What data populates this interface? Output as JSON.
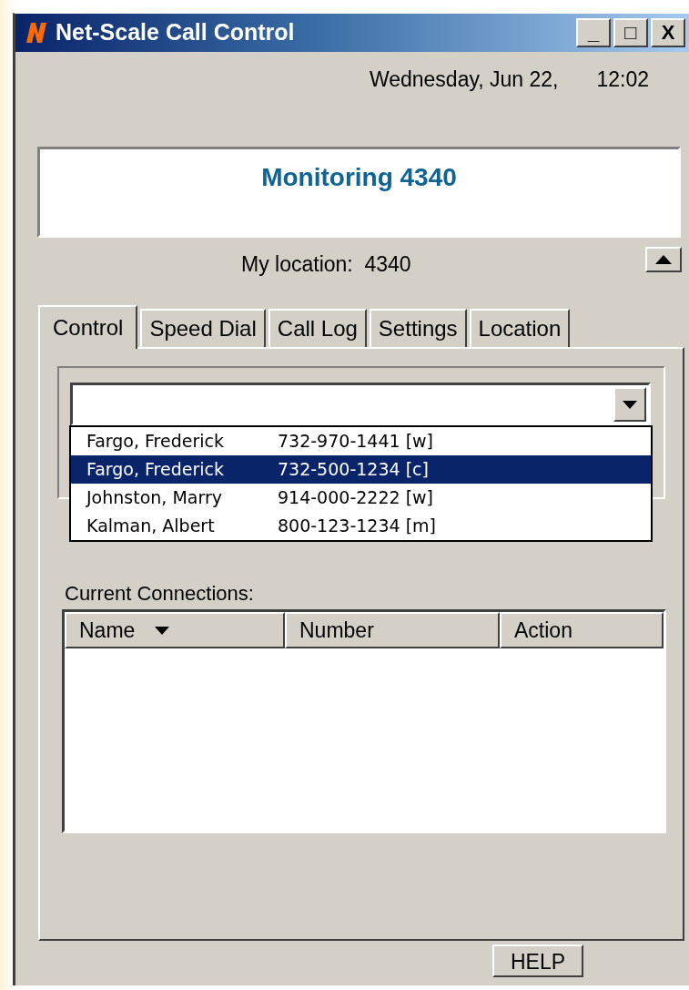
{
  "window": {
    "title": "Net-Scale Call Control",
    "buttons": [
      "_",
      "□",
      "X"
    ]
  },
  "date": "Wednesday, Jun 22,",
  "time": "12:02",
  "status": "Monitoring 4340",
  "location": {
    "label": "My location:",
    "value": "4340"
  },
  "tabs": [
    {
      "label": "Control",
      "selected": true
    },
    {
      "label": "Speed Dial",
      "selected": false
    },
    {
      "label": "Call Log",
      "selected": false
    },
    {
      "label": "Settings",
      "selected": false
    },
    {
      "label": "Location",
      "selected": false
    }
  ],
  "dial_combo": {
    "expanded": true,
    "options": [
      {
        "name": "Fargo, Frederick",
        "number": "732-970-1441 [w]",
        "selected": false
      },
      {
        "name": "Fargo, Frederick",
        "number": "732-500-1234 [c]",
        "selected": true
      },
      {
        "name": "Johnston, Marry",
        "number": "914-000-2222 [w]",
        "selected": false
      },
      {
        "name": "Kalman, Albert",
        "number": "800-123-1234 [m]",
        "selected": false
      }
    ]
  },
  "connections": {
    "label": "Current Connections:",
    "columns": [
      {
        "label": "Name",
        "sorted": true
      },
      {
        "label": "Number",
        "sorted": false
      },
      {
        "label": "Action",
        "sorted": false
      }
    ]
  },
  "help_button": "HELP"
}
